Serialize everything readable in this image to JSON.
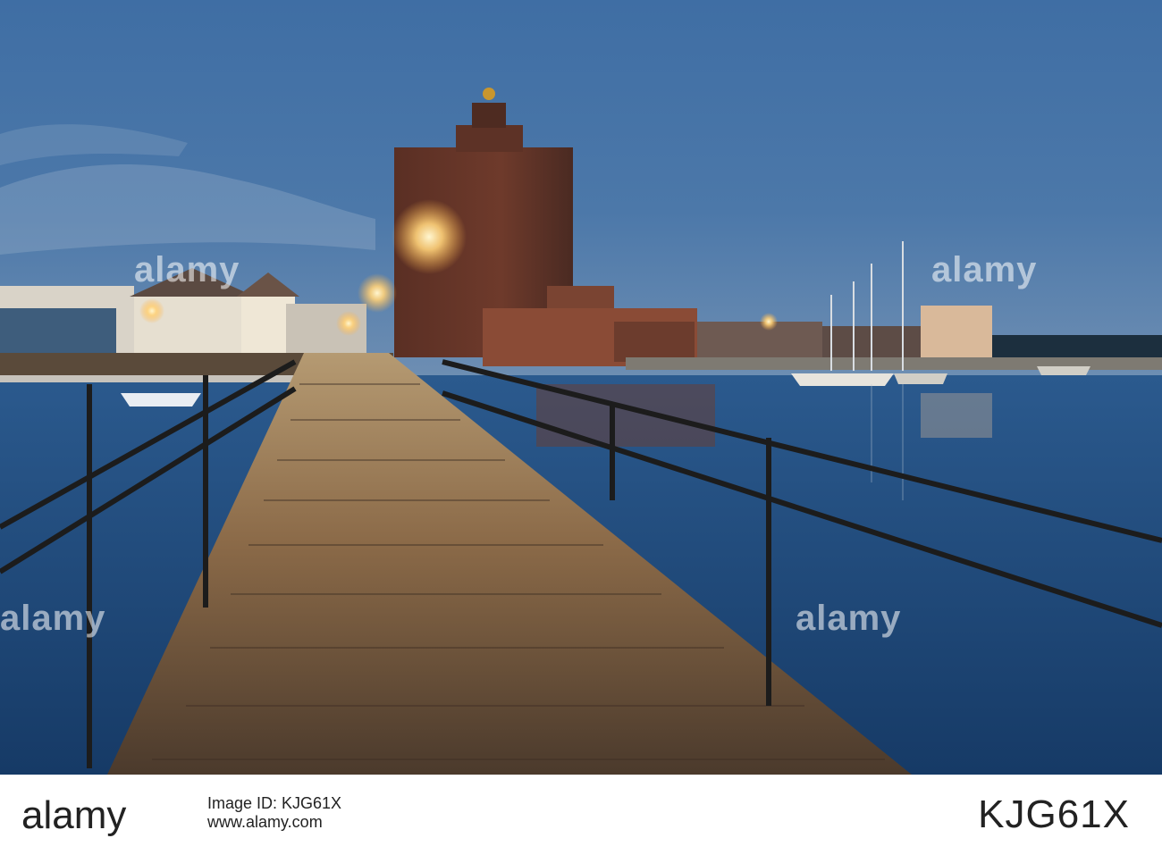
{
  "photo": {
    "alt": "",
    "watermark": "alamy"
  },
  "footer": {
    "brand": "alamy",
    "image_id_label": "Image ID: KJG61X",
    "website": "www.alamy.com",
    "image_code": "KJG61X"
  },
  "colors": {
    "sky_top": "#4a74a8",
    "sky_bottom": "#2c4f78",
    "water": "#1f4f86",
    "brick": "#6b3a2b",
    "deck": "#8a6a4a",
    "light": "#ffd27a"
  }
}
